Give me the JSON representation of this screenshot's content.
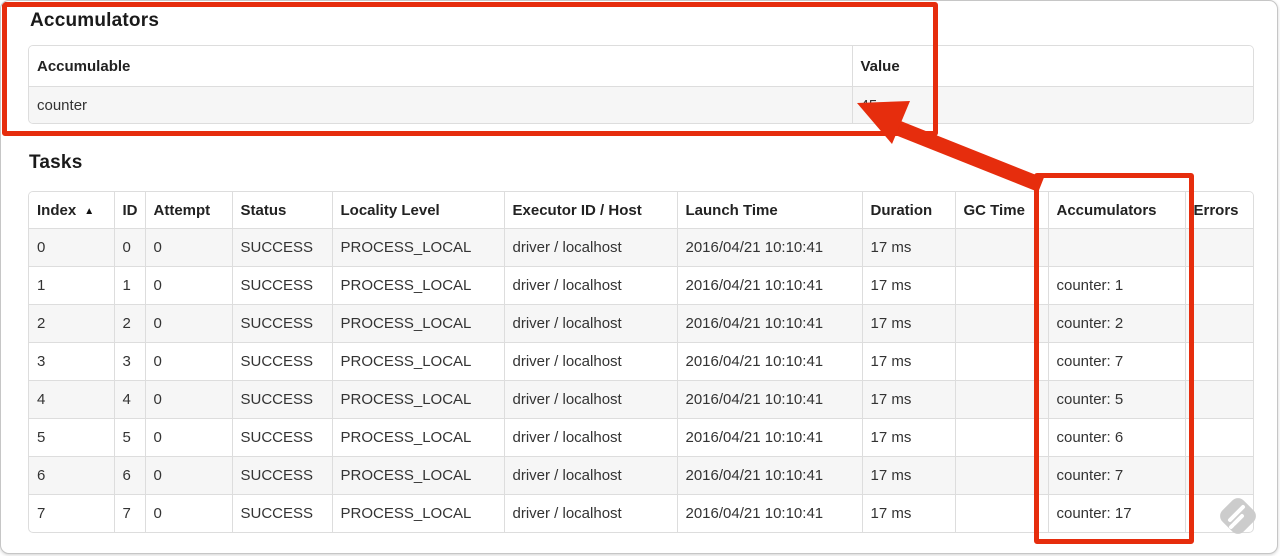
{
  "annotation_color": "#e62d0d",
  "accumulators_section": {
    "title": "Accumulators",
    "table": {
      "headers": {
        "accumulable": "Accumulable",
        "value": "Value"
      },
      "rows": [
        {
          "accumulable": "counter",
          "value": "45"
        }
      ]
    }
  },
  "tasks_section": {
    "title": "Tasks",
    "table": {
      "headers": {
        "index": "Index",
        "sort_icon": "▲",
        "id": "ID",
        "attempt": "Attempt",
        "status": "Status",
        "locality": "Locality Level",
        "executor": "Executor ID / Host",
        "launch": "Launch Time",
        "duration": "Duration",
        "gc": "GC Time",
        "accumulators": "Accumulators",
        "errors": "Errors"
      },
      "rows": [
        {
          "index": "0",
          "id": "0",
          "attempt": "0",
          "status": "SUCCESS",
          "locality": "PROCESS_LOCAL",
          "executor": "driver / localhost",
          "launch": "2016/04/21 10:10:41",
          "duration": "17 ms",
          "gc": "",
          "accumulators": "",
          "errors": ""
        },
        {
          "index": "1",
          "id": "1",
          "attempt": "0",
          "status": "SUCCESS",
          "locality": "PROCESS_LOCAL",
          "executor": "driver / localhost",
          "launch": "2016/04/21 10:10:41",
          "duration": "17 ms",
          "gc": "",
          "accumulators": "counter: 1",
          "errors": ""
        },
        {
          "index": "2",
          "id": "2",
          "attempt": "0",
          "status": "SUCCESS",
          "locality": "PROCESS_LOCAL",
          "executor": "driver / localhost",
          "launch": "2016/04/21 10:10:41",
          "duration": "17 ms",
          "gc": "",
          "accumulators": "counter: 2",
          "errors": ""
        },
        {
          "index": "3",
          "id": "3",
          "attempt": "0",
          "status": "SUCCESS",
          "locality": "PROCESS_LOCAL",
          "executor": "driver / localhost",
          "launch": "2016/04/21 10:10:41",
          "duration": "17 ms",
          "gc": "",
          "accumulators": "counter: 7",
          "errors": ""
        },
        {
          "index": "4",
          "id": "4",
          "attempt": "0",
          "status": "SUCCESS",
          "locality": "PROCESS_LOCAL",
          "executor": "driver / localhost",
          "launch": "2016/04/21 10:10:41",
          "duration": "17 ms",
          "gc": "",
          "accumulators": "counter: 5",
          "errors": ""
        },
        {
          "index": "5",
          "id": "5",
          "attempt": "0",
          "status": "SUCCESS",
          "locality": "PROCESS_LOCAL",
          "executor": "driver / localhost",
          "launch": "2016/04/21 10:10:41",
          "duration": "17 ms",
          "gc": "",
          "accumulators": "counter: 6",
          "errors": ""
        },
        {
          "index": "6",
          "id": "6",
          "attempt": "0",
          "status": "SUCCESS",
          "locality": "PROCESS_LOCAL",
          "executor": "driver / localhost",
          "launch": "2016/04/21 10:10:41",
          "duration": "17 ms",
          "gc": "",
          "accumulators": "counter: 7",
          "errors": ""
        },
        {
          "index": "7",
          "id": "7",
          "attempt": "0",
          "status": "SUCCESS",
          "locality": "PROCESS_LOCAL",
          "executor": "driver / localhost",
          "launch": "2016/04/21 10:10:41",
          "duration": "17 ms",
          "gc": "",
          "accumulators": "counter: 17",
          "errors": ""
        }
      ]
    }
  },
  "watermark": {
    "icon": "feedly-logo",
    "color": "#cccccc"
  }
}
